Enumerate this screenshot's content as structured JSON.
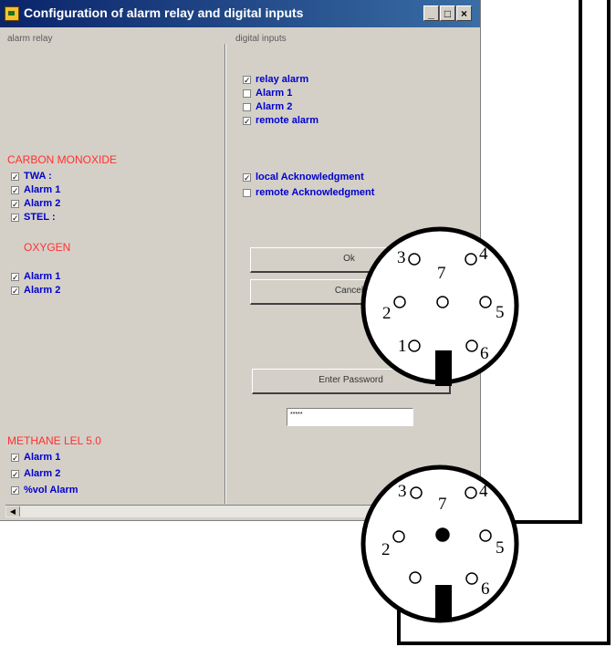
{
  "window": {
    "title": "Configuration of alarm relay and digital inputs",
    "minimize": "_",
    "maximize": "□",
    "close": "×"
  },
  "alarm_relay": {
    "label": "alarm relay",
    "carbon_monoxide": {
      "title": "CARBON MONOXIDE",
      "items": [
        {
          "label": "TWA :",
          "checked": true
        },
        {
          "label": "Alarm 1",
          "checked": true
        },
        {
          "label": "Alarm 2",
          "checked": true
        },
        {
          "label": "STEL :",
          "checked": true
        }
      ]
    },
    "oxygen": {
      "title": "OXYGEN",
      "items": [
        {
          "label": "Alarm 1",
          "checked": true
        },
        {
          "label": "Alarm 2",
          "checked": true
        }
      ]
    },
    "methane": {
      "title": "METHANE LEL 5.0",
      "items": [
        {
          "label": "Alarm 1",
          "checked": true
        },
        {
          "label": "Alarm 2",
          "checked": true
        },
        {
          "label": "%vol Alarm",
          "checked": true
        }
      ]
    }
  },
  "digital_inputs": {
    "label": "digital inputs",
    "items": [
      {
        "label": "relay alarm",
        "checked": true
      },
      {
        "label": "Alarm 1",
        "checked": false
      },
      {
        "label": "Alarm 2",
        "checked": false
      },
      {
        "label": "remote alarm",
        "checked": true
      }
    ],
    "ack_items": [
      {
        "label": "local Acknowledgment",
        "checked": true
      },
      {
        "label": "remote Acknowledgment",
        "checked": false
      }
    ]
  },
  "buttons": {
    "ok": "Ok",
    "cancel": "Cancel",
    "enter_password": "Enter Password"
  },
  "password_field": {
    "value": "*****"
  },
  "connector_top": {
    "pins": [
      "3",
      "7",
      "4",
      "2",
      "5",
      "1",
      "6"
    ]
  },
  "connector_bottom": {
    "pins": [
      "3",
      "7",
      "4",
      "2",
      "5",
      "6"
    ]
  }
}
